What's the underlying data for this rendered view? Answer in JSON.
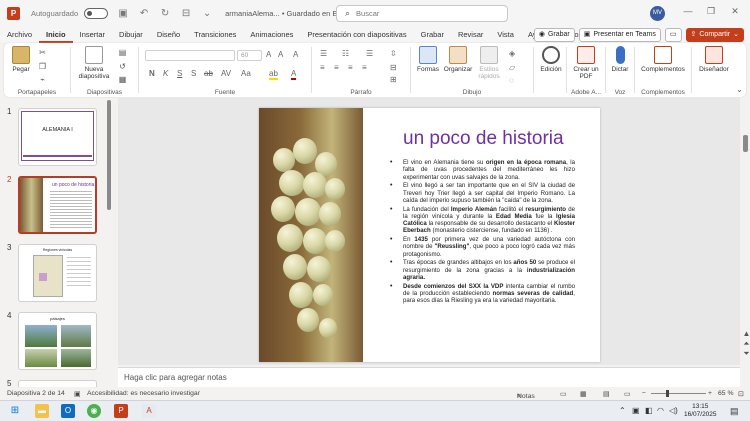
{
  "titlebar": {
    "autosave_label": "Autoguardado",
    "doc_title": "armaniaAlema... • Guardado en Este PC ⌄",
    "search_placeholder": "Buscar",
    "user_initials": "MV",
    "app_letter": "P"
  },
  "menu": [
    "Archivo",
    "Inicio",
    "Insertar",
    "Dibujar",
    "Diseño",
    "Transiciones",
    "Animaciones",
    "Presentación con diapositivas",
    "Grabar",
    "Revisar",
    "Vista",
    "Ayuda",
    "Acrobat"
  ],
  "menu_active": "Inicio",
  "menu_right": {
    "record": "Grabar",
    "present_teams": "Presentar en Teams",
    "share": "Compartir"
  },
  "ribbon": {
    "paste": "Pegar",
    "new_slide": "Nueva diapositiva",
    "shapes": "Formas",
    "arrange": "Organizar",
    "quick_styles": "Estilos rápidos",
    "edit": "Edición",
    "create_pdf": "Crear un PDF",
    "dictate": "Dictar",
    "addins": "Complementos",
    "designer": "Diseñador",
    "font_size": "60",
    "groups": {
      "clipboard": "Portapapeles",
      "slides": "Diapositivas",
      "font": "Fuente",
      "paragraph": "Párrafo",
      "drawing": "Dibujo",
      "adobe": "Adobe A...",
      "voice": "Voz",
      "addins": "Complementos"
    }
  },
  "thumbnails": [
    {
      "num": "1",
      "title": "ALEMANIA I"
    },
    {
      "num": "2",
      "title": "un poco de historia"
    },
    {
      "num": "3",
      "title": "Regiones vinicolas"
    },
    {
      "num": "4",
      "title": "paisajes"
    },
    {
      "num": "5",
      "title": ""
    }
  ],
  "slide": {
    "title": "un poco de historia"
  },
  "notes_placeholder": "Haga clic para agregar notas",
  "status": {
    "slide_count": "Diapositiva 2 de 14",
    "accessibility": "Accesibilidad: es necesario investigar",
    "notes": "Notas",
    "zoom": "65 %"
  },
  "taskbar": {
    "time": "13:15",
    "date": "16/07/2025"
  },
  "colors": {
    "accent": "#c43e1c",
    "title_purple": "#7030a0"
  }
}
